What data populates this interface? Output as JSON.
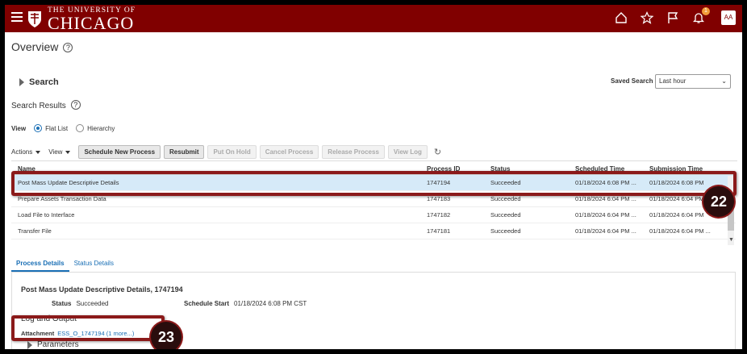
{
  "header": {
    "logo_small": "THE UNIVERSITY OF",
    "logo_big": "CHICAGO",
    "notification_count": "1",
    "avatar_initials": "AA"
  },
  "page": {
    "title": "Overview",
    "search_label": "Search",
    "saved_search_label": "Saved Search",
    "saved_search_value": "Last hour",
    "results_label": "Search Results"
  },
  "view": {
    "label": "View",
    "options": [
      "Flat List",
      "Hierarchy"
    ],
    "selected": "Flat List"
  },
  "toolbar": {
    "actions": "Actions",
    "view": "View",
    "buttons": [
      "Schedule New Process",
      "Resubmit",
      "Put On Hold",
      "Cancel Process",
      "Release Process",
      "View Log"
    ]
  },
  "table": {
    "columns": [
      "Name",
      "Process ID",
      "Status",
      "Scheduled Time",
      "Submission Time"
    ],
    "rows": [
      {
        "name": "Post Mass Update Descriptive Details",
        "pid": "1747194",
        "status": "Succeeded",
        "sched": "01/18/2024 6:08 PM ...",
        "sub": "01/18/2024 6:08 PM"
      },
      {
        "name": "Prepare Assets Transaction Data",
        "pid": "1747183",
        "status": "Succeeded",
        "sched": "01/18/2024 6:04 PM ...",
        "sub": "01/18/2024 6:04 PM"
      },
      {
        "name": "Load File to Interface",
        "pid": "1747182",
        "status": "Succeeded",
        "sched": "01/18/2024 6:04 PM ...",
        "sub": "01/18/2024 6:04 PM"
      },
      {
        "name": "Transfer File",
        "pid": "1747181",
        "status": "Succeeded",
        "sched": "01/18/2024 6:04 PM ...",
        "sub": "01/18/2024 6:04 PM ..."
      }
    ]
  },
  "details": {
    "tabs": [
      "Process Details",
      "Status Details"
    ],
    "title": "Post Mass Update Descriptive Details, 1747194",
    "status_label": "Status",
    "status_value": "Succeeded",
    "schedule_start_label": "Schedule Start",
    "schedule_start_value": "01/18/2024 6:08 PM CST",
    "log_output": "Log and Output",
    "attachment_label": "Attachment",
    "attachment_value": "ESS_O_1747194 (1 more...)",
    "parameters": "Parameters"
  },
  "callouts": [
    "22",
    "23"
  ],
  "colors": {
    "brand": "#800000",
    "callout": "#8b1a1a",
    "link": "#1a6fb5",
    "selected_row": "#d6eaf8"
  }
}
